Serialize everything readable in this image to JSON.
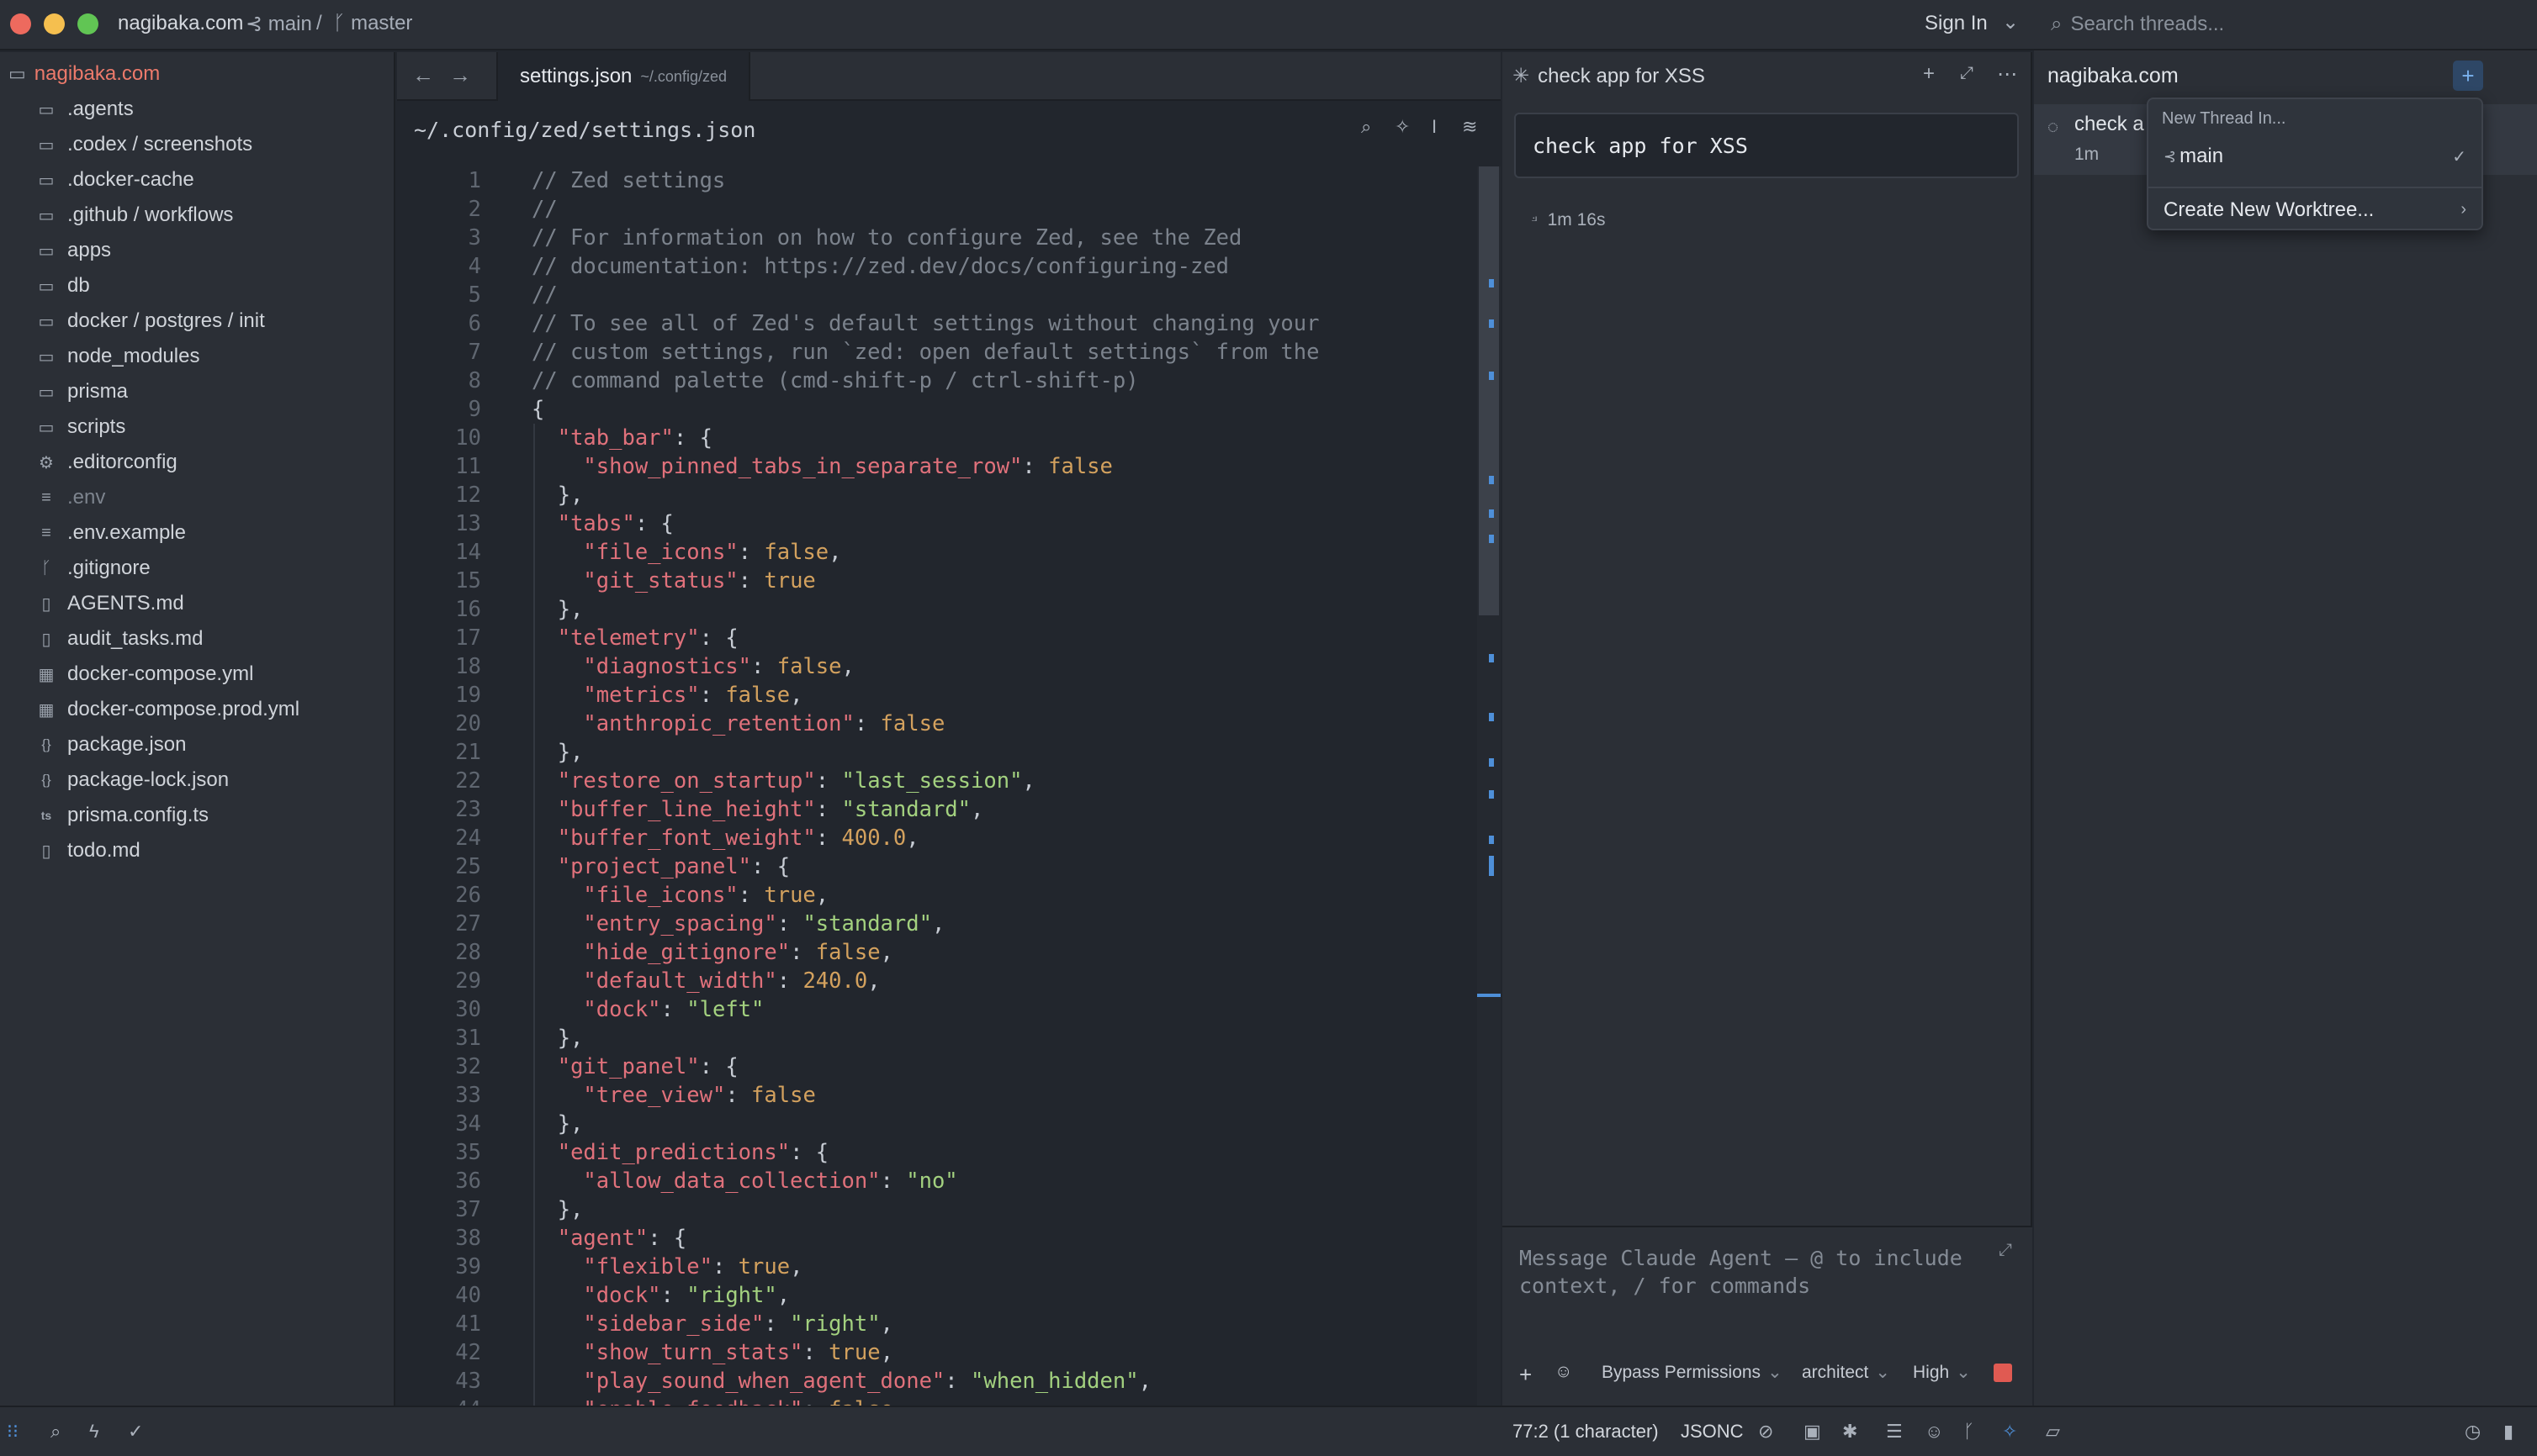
{
  "titlebar": {
    "project": "nagibaka.com",
    "branch": "main",
    "worktree": "master",
    "sign_in": "Sign In"
  },
  "project_panel": {
    "root": "nagibaka.com",
    "items": [
      {
        "label": ".agents",
        "icon": "folder-icon"
      },
      {
        "label": ".codex / screenshots",
        "icon": "folder-icon"
      },
      {
        "label": ".docker-cache",
        "icon": "folder-icon"
      },
      {
        "label": ".github / workflows",
        "icon": "folder-icon"
      },
      {
        "label": "apps",
        "icon": "folder-icon"
      },
      {
        "label": "db",
        "icon": "folder-icon"
      },
      {
        "label": "docker / postgres / init",
        "icon": "folder-icon"
      },
      {
        "label": "node_modules",
        "icon": "folder-icon"
      },
      {
        "label": "prisma",
        "icon": "folder-icon"
      },
      {
        "label": "scripts",
        "icon": "folder-icon"
      },
      {
        "label": ".editorconfig",
        "icon": "gear-icon"
      },
      {
        "label": ".env",
        "icon": "lines-icon"
      },
      {
        "label": ".env.example",
        "icon": "lines-icon"
      },
      {
        "label": ".gitignore",
        "icon": "git-icon"
      },
      {
        "label": "AGENTS.md",
        "icon": "book-icon"
      },
      {
        "label": "audit_tasks.md",
        "icon": "book-icon"
      },
      {
        "label": "docker-compose.yml",
        "icon": "docker-icon"
      },
      {
        "label": "docker-compose.prod.yml",
        "icon": "docker-icon"
      },
      {
        "label": "package.json",
        "icon": "braces-icon"
      },
      {
        "label": "package-lock.json",
        "icon": "braces-icon"
      },
      {
        "label": "prisma.config.ts",
        "icon": "ts-icon"
      },
      {
        "label": "todo.md",
        "icon": "book-icon"
      }
    ]
  },
  "editor": {
    "tab_name": "settings.json",
    "tab_path": "~/.config/zed",
    "breadcrumb": "~/.config/zed/settings.json",
    "lines": [
      [
        [
          "c",
          "// Zed settings"
        ]
      ],
      [
        [
          "c",
          "//"
        ]
      ],
      [
        [
          "c",
          "// For information on how to configure Zed, see the Zed"
        ]
      ],
      [
        [
          "c",
          "// documentation: https://zed.dev/docs/configuring-zed"
        ]
      ],
      [
        [
          "c",
          "//"
        ]
      ],
      [
        [
          "c",
          "// To see all of Zed's default settings without changing your"
        ]
      ],
      [
        [
          "c",
          "// custom settings, run `zed: open default settings` from the"
        ]
      ],
      [
        [
          "c",
          "// command palette (cmd-shift-p / ctrl-shift-p)"
        ]
      ],
      [
        [
          "p",
          "{"
        ]
      ],
      [
        [
          "p",
          "  "
        ],
        [
          "k",
          "\"tab_bar\""
        ],
        [
          "p",
          ": {"
        ]
      ],
      [
        [
          "p",
          "    "
        ],
        [
          "k",
          "\"show_pinned_tabs_in_separate_row\""
        ],
        [
          "p",
          ": "
        ],
        [
          "b",
          "false"
        ]
      ],
      [
        [
          "p",
          "  },"
        ]
      ],
      [
        [
          "p",
          "  "
        ],
        [
          "k",
          "\"tabs\""
        ],
        [
          "p",
          ": {"
        ]
      ],
      [
        [
          "p",
          "    "
        ],
        [
          "k",
          "\"file_icons\""
        ],
        [
          "p",
          ": "
        ],
        [
          "b",
          "false"
        ],
        [
          "p",
          ","
        ]
      ],
      [
        [
          "p",
          "    "
        ],
        [
          "k",
          "\"git_status\""
        ],
        [
          "p",
          ": "
        ],
        [
          "b",
          "true"
        ]
      ],
      [
        [
          "p",
          "  },"
        ]
      ],
      [
        [
          "p",
          "  "
        ],
        [
          "k",
          "\"telemetry\""
        ],
        [
          "p",
          ": {"
        ]
      ],
      [
        [
          "p",
          "    "
        ],
        [
          "k",
          "\"diagnostics\""
        ],
        [
          "p",
          ": "
        ],
        [
          "b",
          "false"
        ],
        [
          "p",
          ","
        ]
      ],
      [
        [
          "p",
          "    "
        ],
        [
          "k",
          "\"metrics\""
        ],
        [
          "p",
          ": "
        ],
        [
          "b",
          "false"
        ],
        [
          "p",
          ","
        ]
      ],
      [
        [
          "p",
          "    "
        ],
        [
          "k",
          "\"anthropic_retention\""
        ],
        [
          "p",
          ": "
        ],
        [
          "b",
          "false"
        ]
      ],
      [
        [
          "p",
          "  },"
        ]
      ],
      [
        [
          "p",
          "  "
        ],
        [
          "k",
          "\"restore_on_startup\""
        ],
        [
          "p",
          ": "
        ],
        [
          "s",
          "\"last_session\""
        ],
        [
          "p",
          ","
        ]
      ],
      [
        [
          "p",
          "  "
        ],
        [
          "k",
          "\"buffer_line_height\""
        ],
        [
          "p",
          ": "
        ],
        [
          "s",
          "\"standard\""
        ],
        [
          "p",
          ","
        ]
      ],
      [
        [
          "p",
          "  "
        ],
        [
          "k",
          "\"buffer_font_weight\""
        ],
        [
          "p",
          ": "
        ],
        [
          "n",
          "400.0"
        ],
        [
          "p",
          ","
        ]
      ],
      [
        [
          "p",
          "  "
        ],
        [
          "k",
          "\"project_panel\""
        ],
        [
          "p",
          ": {"
        ]
      ],
      [
        [
          "p",
          "    "
        ],
        [
          "k",
          "\"file_icons\""
        ],
        [
          "p",
          ": "
        ],
        [
          "b",
          "true"
        ],
        [
          "p",
          ","
        ]
      ],
      [
        [
          "p",
          "    "
        ],
        [
          "k",
          "\"entry_spacing\""
        ],
        [
          "p",
          ": "
        ],
        [
          "s",
          "\"standard\""
        ],
        [
          "p",
          ","
        ]
      ],
      [
        [
          "p",
          "    "
        ],
        [
          "k",
          "\"hide_gitignore\""
        ],
        [
          "p",
          ": "
        ],
        [
          "b",
          "false"
        ],
        [
          "p",
          ","
        ]
      ],
      [
        [
          "p",
          "    "
        ],
        [
          "k",
          "\"default_width\""
        ],
        [
          "p",
          ": "
        ],
        [
          "n",
          "240.0"
        ],
        [
          "p",
          ","
        ]
      ],
      [
        [
          "p",
          "    "
        ],
        [
          "k",
          "\"dock\""
        ],
        [
          "p",
          ": "
        ],
        [
          "s",
          "\"left\""
        ]
      ],
      [
        [
          "p",
          "  },"
        ]
      ],
      [
        [
          "p",
          "  "
        ],
        [
          "k",
          "\"git_panel\""
        ],
        [
          "p",
          ": {"
        ]
      ],
      [
        [
          "p",
          "    "
        ],
        [
          "k",
          "\"tree_view\""
        ],
        [
          "p",
          ": "
        ],
        [
          "b",
          "false"
        ]
      ],
      [
        [
          "p",
          "  },"
        ]
      ],
      [
        [
          "p",
          "  "
        ],
        [
          "k",
          "\"edit_predictions\""
        ],
        [
          "p",
          ": {"
        ]
      ],
      [
        [
          "p",
          "    "
        ],
        [
          "k",
          "\"allow_data_collection\""
        ],
        [
          "p",
          ": "
        ],
        [
          "s",
          "\"no\""
        ]
      ],
      [
        [
          "p",
          "  },"
        ]
      ],
      [
        [
          "p",
          "  "
        ],
        [
          "k",
          "\"agent\""
        ],
        [
          "p",
          ": {"
        ]
      ],
      [
        [
          "p",
          "    "
        ],
        [
          "k",
          "\"flexible\""
        ],
        [
          "p",
          ": "
        ],
        [
          "b",
          "true"
        ],
        [
          "p",
          ","
        ]
      ],
      [
        [
          "p",
          "    "
        ],
        [
          "k",
          "\"dock\""
        ],
        [
          "p",
          ": "
        ],
        [
          "s",
          "\"right\""
        ],
        [
          "p",
          ","
        ]
      ],
      [
        [
          "p",
          "    "
        ],
        [
          "k",
          "\"sidebar_side\""
        ],
        [
          "p",
          ": "
        ],
        [
          "s",
          "\"right\""
        ],
        [
          "p",
          ","
        ]
      ],
      [
        [
          "p",
          "    "
        ],
        [
          "k",
          "\"show_turn_stats\""
        ],
        [
          "p",
          ": "
        ],
        [
          "b",
          "true"
        ],
        [
          "p",
          ","
        ]
      ],
      [
        [
          "p",
          "    "
        ],
        [
          "k",
          "\"play_sound_when_agent_done\""
        ],
        [
          "p",
          ": "
        ],
        [
          "s",
          "\"when_hidden\""
        ],
        [
          "p",
          ","
        ]
      ],
      [
        [
          "p",
          "    "
        ],
        [
          "k",
          "\"enable_feedback\""
        ],
        [
          "p",
          ": "
        ],
        [
          "b",
          "false"
        ]
      ]
    ]
  },
  "agent_panel": {
    "title": "check app for XSS",
    "user_message": "check app for XSS",
    "elapsed": "1m 16s",
    "composer_placeholder": "Message Claude Agent — @ to include context, / for commands",
    "permissions": "Bypass Permissions",
    "mode": "architect",
    "effort": "High"
  },
  "threads_panel": {
    "search_placeholder": "Search threads...",
    "project": "nagibaka.com",
    "thread_title": "check a",
    "thread_time": "1m"
  },
  "dropdown": {
    "header": "New Thread In...",
    "item_main": "main",
    "item_worktree": "Create New Worktree..."
  },
  "statusbar": {
    "cursor": "77:2 (1 character)",
    "language": "JSONC"
  },
  "colors": {
    "accent": "#4e8fd8",
    "project_root": "#ec7a6b",
    "stop": "#e05a52"
  }
}
